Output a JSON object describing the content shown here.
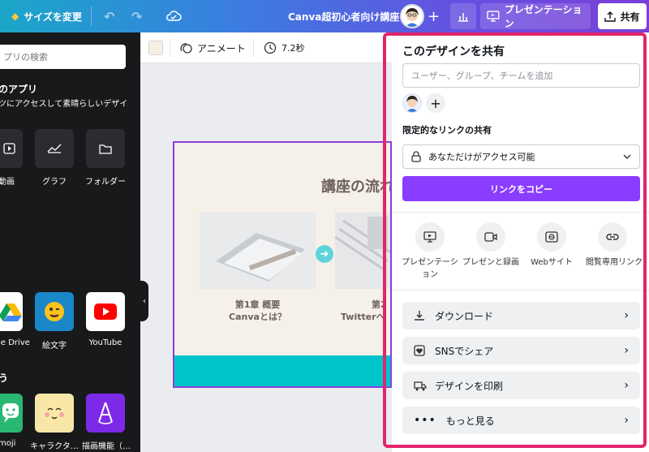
{
  "topbar": {
    "resize_label": "サイズを変更",
    "doc_title": "Canva超初心者向け講座",
    "present_label": "プレゼンテーション",
    "share_label": "共有"
  },
  "sidebar": {
    "search_placeholder": "プリの検索",
    "section_title": "のアプリ",
    "section_desc": "ツにアクセスして素晴らしいデザイ",
    "apps_row1": [
      {
        "label": "動画",
        "icon": "video-icon"
      },
      {
        "label": "グラフ",
        "icon": "chart-icon"
      },
      {
        "label": "フォルダー",
        "icon": "folder-icon"
      }
    ],
    "apps_row2": [
      {
        "label": "le Drive",
        "icon": "google-drive-icon"
      },
      {
        "label": "絵文字",
        "icon": "emoji-icon"
      },
      {
        "label": "YouTube",
        "icon": "youtube-icon"
      }
    ],
    "section2_title": "う",
    "apps_row3": [
      {
        "label": "moji",
        "icon": "bitmoji-icon"
      },
      {
        "label": "キャラクタ…",
        "icon": "character-icon"
      },
      {
        "label": "描画機能（…",
        "icon": "draw-icon"
      }
    ]
  },
  "canvas_toolbar": {
    "animate_label": "アニメート",
    "duration_label": "7.2秒"
  },
  "slide": {
    "title": "講座の流れ",
    "card1_line1": "第1章 概要",
    "card1_line2": "Canvaとは？",
    "card2_line1": "第2",
    "card2_line2": "Twitterへ"
  },
  "share_panel": {
    "title": "このデザインを共有",
    "invite_placeholder": "ユーザー、グループ、チームを追加",
    "link_section_title": "限定的なリンクの共有",
    "access_value": "あなただけがアクセス可能",
    "copy_link_label": "リンクをコピー",
    "share_options": [
      {
        "label1": "プレゼンテーシ",
        "label2": "ョン",
        "icon": "present-icon"
      },
      {
        "label1": "プレゼンと録画",
        "label2": "",
        "icon": "record-icon"
      },
      {
        "label1": "Webサイト",
        "label2": "",
        "icon": "website-icon"
      },
      {
        "label1": "閲覧専用リンク",
        "label2": "",
        "icon": "link-icon"
      }
    ],
    "actions": [
      {
        "label": "ダウンロード",
        "icon": "download-icon"
      },
      {
        "label": "SNSでシェア",
        "icon": "heart-icon"
      },
      {
        "label": "デザインを印刷",
        "icon": "truck-icon"
      },
      {
        "label": "もっと見る",
        "icon": "more-icon"
      }
    ]
  },
  "colors": {
    "accent_purple": "#7d2ae8",
    "highlight_pink": "#e0256c",
    "slide_bg": "#f5f1e8",
    "slide_teal": "#00c4cc"
  }
}
